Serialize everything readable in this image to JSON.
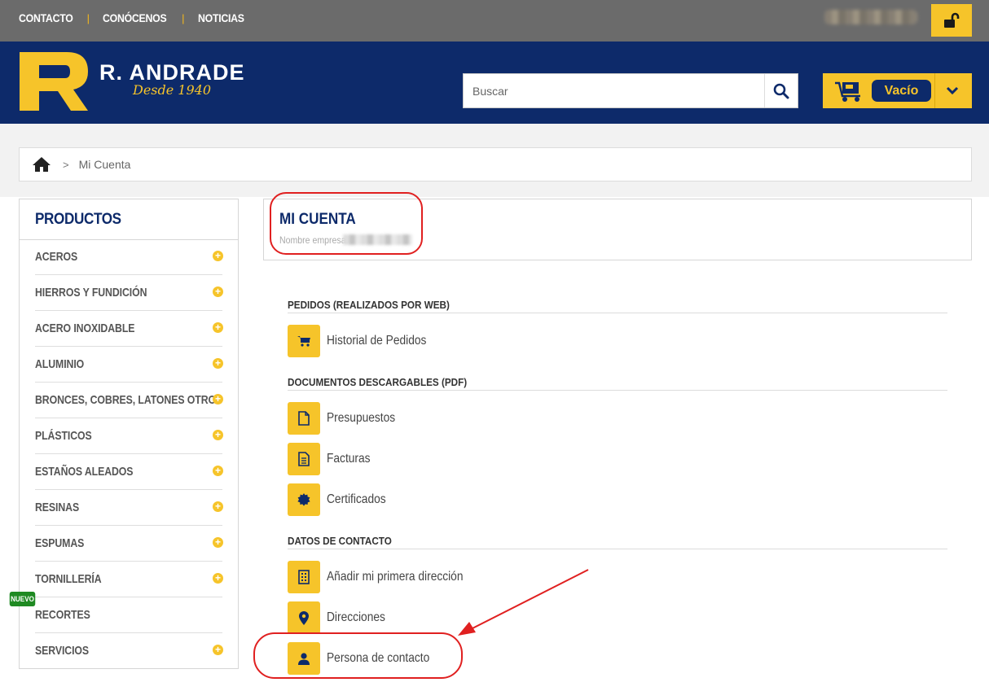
{
  "topbar": {
    "nav": [
      "CONTACTO",
      "CONÓCENOS",
      "NOTICIAS"
    ],
    "separator": "|"
  },
  "header": {
    "brand": "R. ANDRADE",
    "tagline": "Desde 1940",
    "search_placeholder": "Buscar",
    "cart_label": "Vacío"
  },
  "breadcrumb": {
    "separator": ">",
    "current": "Mi Cuenta"
  },
  "sidebar": {
    "title": "PRODUCTOS",
    "badge": "NUEVO",
    "items": [
      {
        "label": "ACEROS",
        "expandable": true
      },
      {
        "label": "HIERROS Y FUNDICIÓN",
        "expandable": true
      },
      {
        "label": "ACERO INOXIDABLE",
        "expandable": true
      },
      {
        "label": "ALUMINIO",
        "expandable": true
      },
      {
        "label": "BRONCES, COBRES, LATONES OTROS",
        "expandable": true
      },
      {
        "label": "PLÁSTICOS",
        "expandable": true
      },
      {
        "label": "ESTAÑOS ALEADOS",
        "expandable": true
      },
      {
        "label": "RESINAS",
        "expandable": true
      },
      {
        "label": "ESPUMAS",
        "expandable": true
      },
      {
        "label": "TORNILLERÍA",
        "expandable": true
      },
      {
        "label": "RECORTES",
        "expandable": false
      },
      {
        "label": "SERVICIOS",
        "expandable": true
      }
    ]
  },
  "account": {
    "title": "MI CUENTA",
    "company_label": "Nombre empresa:"
  },
  "sections": {
    "orders": {
      "heading": "PEDIDOS (REALIZADOS POR WEB)",
      "links": [
        {
          "label": "Historial de Pedidos",
          "icon": "cart-icon"
        }
      ]
    },
    "documents": {
      "heading": "DOCUMENTOS DESCARGABLES (PDF)",
      "links": [
        {
          "label": "Presupuestos",
          "icon": "file-icon"
        },
        {
          "label": "Facturas",
          "icon": "file-text-icon"
        },
        {
          "label": "Certificados",
          "icon": "certificate-icon"
        }
      ]
    },
    "contact": {
      "heading": "DATOS DE CONTACTO",
      "links": [
        {
          "label": "Añadir mi primera dirección",
          "icon": "building-icon"
        },
        {
          "label": "Direcciones",
          "icon": "map-marker-icon"
        },
        {
          "label": "Persona de contacto",
          "icon": "user-icon"
        }
      ]
    }
  },
  "colors": {
    "navy": "#0d2a6a",
    "yellow": "#f6c42a",
    "topbar_gray": "#6b6b6b",
    "annotation_red": "#e02020",
    "badge_green": "#1f8a22"
  }
}
